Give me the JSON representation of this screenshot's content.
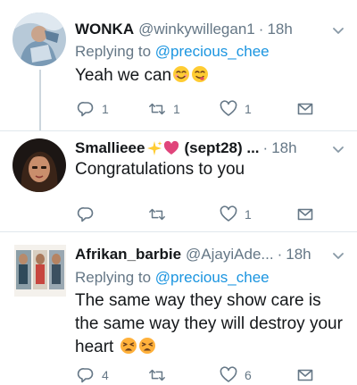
{
  "tweets": [
    {
      "name": "WONKA",
      "handle": "@winkywillegan1",
      "time": "18h",
      "replying_label": "Replying to",
      "replying_to": "@precious_chee",
      "text": "Yeah we can",
      "emojis": [
        "smiling-face-with-smiling-eyes",
        "face-savoring-food"
      ],
      "replies": "1",
      "retweets": "1",
      "likes": "1"
    },
    {
      "name": "Smallieee",
      "handle_suffix": "(sept28) ...",
      "name_emojis": [
        "sparkles",
        "pink-heart"
      ],
      "time": "18h",
      "text": "Congratulations to you",
      "replies": "",
      "retweets": "",
      "likes": "1"
    },
    {
      "name": "Afrikan_barbie",
      "handle": "@AjayiAde...",
      "time": "18h",
      "replying_label": "Replying to",
      "replying_to": "@precious_chee",
      "text": "The same way they show care is the same way they will destroy your heart",
      "emojis": [
        "tired-face",
        "tired-face"
      ],
      "replies": "4",
      "retweets": "",
      "likes": "6"
    }
  ],
  "icons": {
    "reply": "reply-icon",
    "retweet": "retweet-icon",
    "like": "heart-icon",
    "share": "share-icon",
    "caret": "chevron-down-icon"
  },
  "colors": {
    "secondary_text": "#657786",
    "link": "#1b95e0",
    "divider": "#e1e8ed",
    "icon": "#657786"
  }
}
